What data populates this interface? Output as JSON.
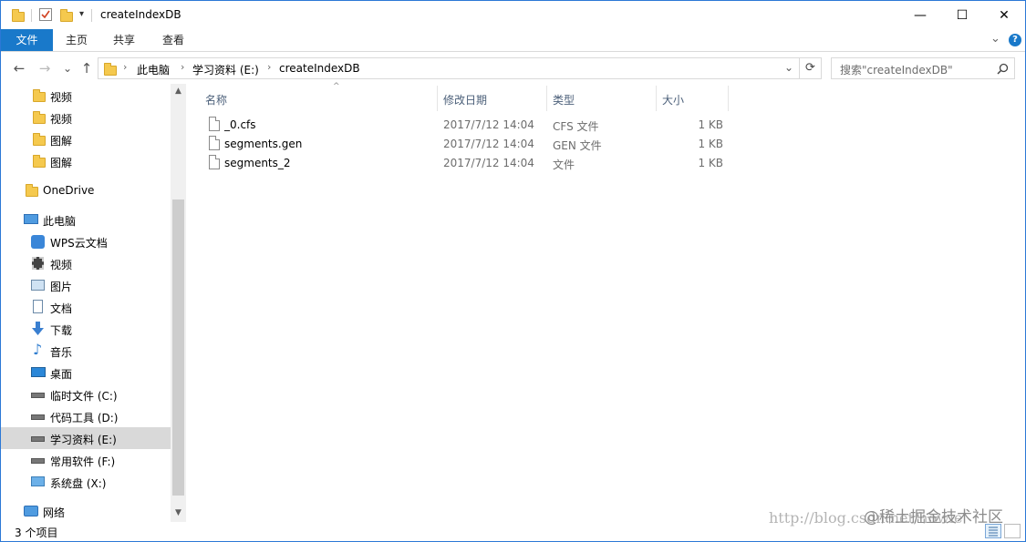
{
  "title_bar": {
    "title": "createIndexDB",
    "minimize_glyph": "—",
    "maximize_glyph": "☐",
    "close_glyph": "✕"
  },
  "ribbon": {
    "tabs": [
      "文件",
      "主页",
      "共享",
      "查看"
    ],
    "expand_glyph": "⌄",
    "help_glyph": "?"
  },
  "address": {
    "back_glyph": "←",
    "forward_glyph": "→",
    "recent_glyph": "⌄",
    "up_glyph": "↑",
    "breadcrumb": [
      "此电脑",
      "学习资料 (E:)",
      "createIndexDB"
    ],
    "dropdown_glyph": "⌄",
    "refresh_glyph": "⟳"
  },
  "search": {
    "placeholder": "搜索\"createIndexDB\""
  },
  "nav": {
    "quick_items": [
      "视频",
      "视频",
      "图解",
      "图解"
    ],
    "onedrive": "OneDrive",
    "this_pc": "此电脑",
    "pc_items": [
      "WPS云文档",
      "视频",
      "图片",
      "文档",
      "下载",
      "音乐",
      "桌面",
      "临时文件 (C:)",
      "代码工具 (D:)",
      "学习资料 (E:)",
      "常用软件 (F:)",
      "系统盘 (X:)"
    ],
    "network": "网络",
    "selected": "学习资料 (E:)"
  },
  "list": {
    "columns": [
      "名称",
      "修改日期",
      "类型",
      "大小"
    ],
    "sort_glyph": "^",
    "rows": [
      {
        "name": "_0.cfs",
        "date": "2017/7/12 14:04",
        "type": "CFS 文件",
        "size": "1 KB"
      },
      {
        "name": "segments.gen",
        "date": "2017/7/12 14:04",
        "type": "GEN 文件",
        "size": "1 KB"
      },
      {
        "name": "segments_2",
        "date": "2017/7/12 14:04",
        "type": "文件",
        "size": "1 KB"
      }
    ]
  },
  "status": {
    "count": "3 个项目"
  },
  "watermark": {
    "url": "http://blog.csdn.net/howie",
    "community": "@稀土掘金技术社区"
  },
  "colors": {
    "accent": "#1979ca",
    "selected_bg": "#d9d9d9",
    "folder": "#f5c94e"
  }
}
